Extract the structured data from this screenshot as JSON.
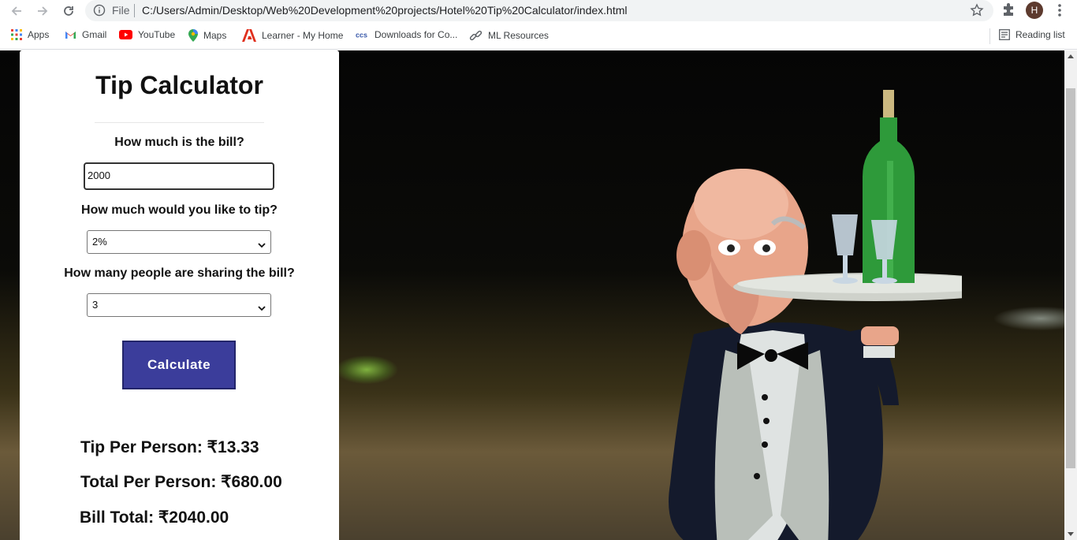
{
  "browser": {
    "file_label": "File",
    "url": "C:/Users/Admin/Desktop/Web%20Development%20projects/Hotel%20Tip%20Calculator/index.html",
    "avatar_letter": "H",
    "bookmarks": [
      {
        "label": "Apps",
        "icon": "apps-grid-icon"
      },
      {
        "label": "Gmail",
        "icon": "gmail-icon"
      },
      {
        "label": "YouTube",
        "icon": "youtube-icon"
      },
      {
        "label": "Maps",
        "icon": "maps-icon"
      },
      {
        "label": "Learner - My Home",
        "icon": "learner-icon"
      },
      {
        "label": "Downloads for Co...",
        "icon": "downloads-icon"
      },
      {
        "label": "ML Resources",
        "icon": "link-icon"
      }
    ],
    "reading_list": "Reading list"
  },
  "calculator": {
    "title": "Tip Calculator",
    "bill_question": "How much is the bill?",
    "bill_value": "2000",
    "tip_question": "How much would you like to tip?",
    "tip_selected": "2%",
    "people_question": "How many people are sharing the bill?",
    "people_selected": "3",
    "calculate_label": "Calculate",
    "tip_per_person": "Tip Per Person: ₹13.33",
    "total_per_person": "Total Per Person: ₹680.00",
    "bill_total": "Bill Total: ₹2040.00"
  },
  "colors": {
    "button_bg": "#3b3d9b",
    "card_bg": "#ffffff"
  }
}
